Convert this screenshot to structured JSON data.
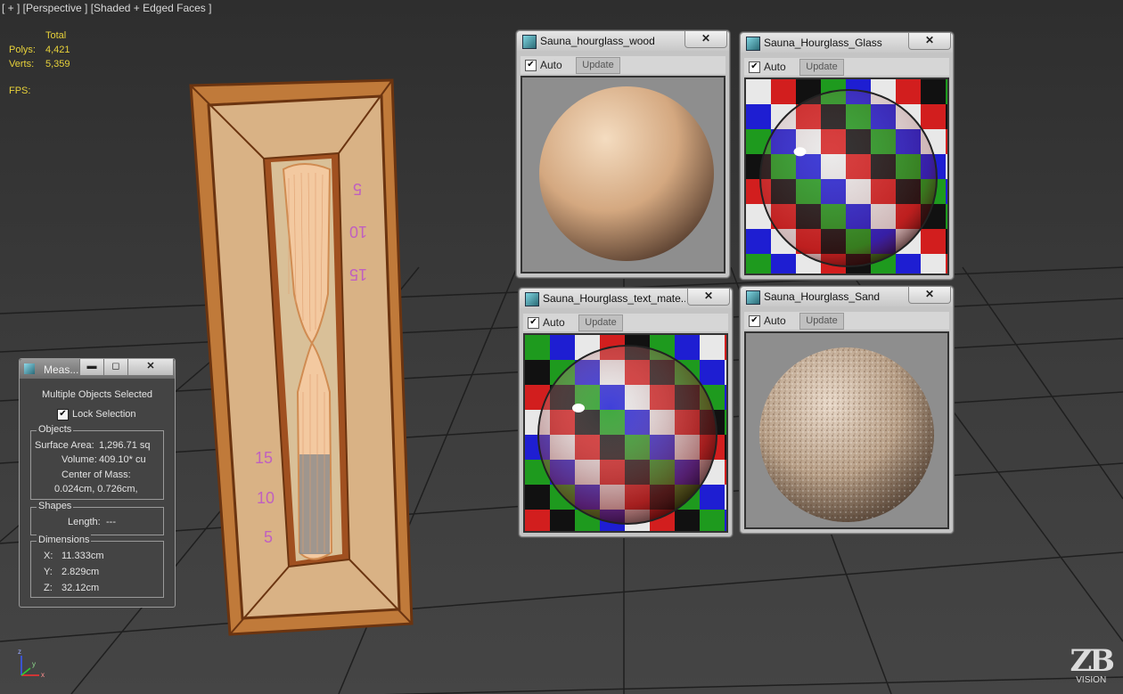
{
  "viewport": {
    "label": "[ + ] [Perspective ] [Shaded + Edged Faces ]",
    "stats_header": "Total",
    "polys_label": "Polys:",
    "polys_value": "4,421",
    "verts_label": "Verts:",
    "verts_value": "5,359",
    "fps_label": "FPS:",
    "frame_numbers": [
      "5",
      "10",
      "15",
      "15",
      "10",
      "5"
    ],
    "axis": {
      "z": "z",
      "x": "x",
      "y": "y"
    }
  },
  "material_windows": [
    {
      "title": "Sauna_hourglass_wood",
      "close": "✕",
      "auto_label": "Auto",
      "auto_checked": "✔",
      "update_label": "Update"
    },
    {
      "title": "Sauna_Hourglass_Glass",
      "close": "✕",
      "auto_label": "Auto",
      "auto_checked": "✔",
      "update_label": "Update"
    },
    {
      "title": "Sauna_Hourglass_text_mate...",
      "close": "✕",
      "auto_label": "Auto",
      "auto_checked": "✔",
      "update_label": "Update"
    },
    {
      "title": "Sauna_Hourglass_Sand",
      "close": "✕",
      "auto_label": "Auto",
      "auto_checked": "✔",
      "update_label": "Update"
    }
  ],
  "measure": {
    "title": "Meas...",
    "minimize": "▬",
    "restore": "◻",
    "close": "✕",
    "header": "Multiple Objects Selected",
    "lock_checked": "✔",
    "lock_label": "Lock Selection",
    "objects_title": "Objects",
    "surface_area_label": "Surface Area:",
    "surface_area": "1,296.71 sq",
    "volume_label": "Volume:",
    "volume": "409.10* cu",
    "center_label": "Center of Mass:",
    "center": "0.024cm, 0.726cm,",
    "shapes_title": "Shapes",
    "length_label": "Length:",
    "length": "---",
    "dimensions_title": "Dimensions",
    "x_label": "X:",
    "x": "11.333cm",
    "y_label": "Y:",
    "y": "2.829cm",
    "z_label": "Z:",
    "z": "32.12cm"
  },
  "watermark": {
    "logo": "ZB",
    "text": "VISION"
  },
  "colors": {
    "checker": [
      "#e8e8e8",
      "#1e9a1e",
      "#d21e1e",
      "#1e1ed2",
      "#111111"
    ]
  }
}
